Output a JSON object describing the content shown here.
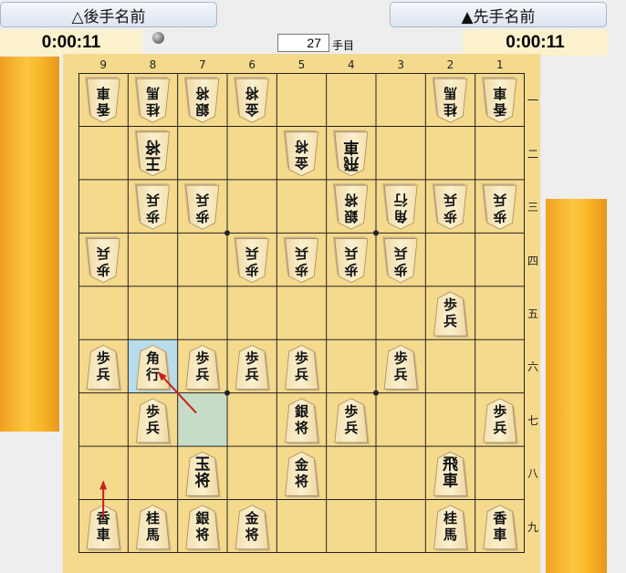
{
  "header": {
    "gote_name": "△後手名前",
    "sente_name": "▲先手名前",
    "gote_clock": "0:00:11",
    "sente_clock": "0:00:11",
    "move_number": "27",
    "move_unit": "手目"
  },
  "board": {
    "files": [
      "9",
      "8",
      "7",
      "6",
      "5",
      "4",
      "3",
      "2",
      "1"
    ],
    "ranks": [
      "一",
      "二",
      "三",
      "四",
      "五",
      "六",
      "七",
      "八",
      "九"
    ],
    "highlight_squares": [
      {
        "file": 8,
        "rank": 6
      },
      {
        "file": 7,
        "rank": 7
      }
    ],
    "last_move": {
      "from": {
        "file": 7,
        "rank": 7
      },
      "to": {
        "file": 8,
        "rank": 6
      }
    },
    "arrows": [
      {
        "from": {
          "file": 7,
          "rank": 7
        },
        "to": {
          "file": 8,
          "rank": 6
        },
        "color": "#c8201c"
      },
      {
        "from": {
          "file": 9,
          "rank": 9
        },
        "to": {
          "file": 9,
          "rank": 8
        },
        "color": "#c8201c"
      }
    ],
    "pieces": [
      {
        "file": 9,
        "rank": 1,
        "owner": "gote",
        "chars": "香車"
      },
      {
        "file": 8,
        "rank": 1,
        "owner": "gote",
        "chars": "桂馬"
      },
      {
        "file": 7,
        "rank": 1,
        "owner": "gote",
        "chars": "銀将"
      },
      {
        "file": 6,
        "rank": 1,
        "owner": "gote",
        "chars": "金将"
      },
      {
        "file": 2,
        "rank": 1,
        "owner": "gote",
        "chars": "桂馬"
      },
      {
        "file": 1,
        "rank": 1,
        "owner": "gote",
        "chars": "香車"
      },
      {
        "file": 8,
        "rank": 2,
        "owner": "gote",
        "chars": "王将",
        "king": true
      },
      {
        "file": 5,
        "rank": 2,
        "owner": "gote",
        "chars": "金将"
      },
      {
        "file": 4,
        "rank": 2,
        "owner": "gote",
        "chars": "飛車",
        "bold": true
      },
      {
        "file": 8,
        "rank": 3,
        "owner": "gote",
        "chars": "歩兵"
      },
      {
        "file": 7,
        "rank": 3,
        "owner": "gote",
        "chars": "歩兵"
      },
      {
        "file": 4,
        "rank": 3,
        "owner": "gote",
        "chars": "銀将"
      },
      {
        "file": 3,
        "rank": 3,
        "owner": "gote",
        "chars": "角行"
      },
      {
        "file": 2,
        "rank": 3,
        "owner": "gote",
        "chars": "歩兵"
      },
      {
        "file": 1,
        "rank": 3,
        "owner": "gote",
        "chars": "歩兵"
      },
      {
        "file": 9,
        "rank": 4,
        "owner": "gote",
        "chars": "歩兵"
      },
      {
        "file": 6,
        "rank": 4,
        "owner": "gote",
        "chars": "歩兵"
      },
      {
        "file": 5,
        "rank": 4,
        "owner": "gote",
        "chars": "歩兵"
      },
      {
        "file": 4,
        "rank": 4,
        "owner": "gote",
        "chars": "歩兵"
      },
      {
        "file": 3,
        "rank": 4,
        "owner": "gote",
        "chars": "歩兵"
      },
      {
        "file": 2,
        "rank": 5,
        "owner": "sente",
        "chars": "歩兵"
      },
      {
        "file": 9,
        "rank": 6,
        "owner": "sente",
        "chars": "歩兵"
      },
      {
        "file": 8,
        "rank": 6,
        "owner": "sente",
        "chars": "角行"
      },
      {
        "file": 7,
        "rank": 6,
        "owner": "sente",
        "chars": "歩兵"
      },
      {
        "file": 6,
        "rank": 6,
        "owner": "sente",
        "chars": "歩兵"
      },
      {
        "file": 5,
        "rank": 6,
        "owner": "sente",
        "chars": "歩兵"
      },
      {
        "file": 3,
        "rank": 6,
        "owner": "sente",
        "chars": "歩兵"
      },
      {
        "file": 8,
        "rank": 7,
        "owner": "sente",
        "chars": "歩兵"
      },
      {
        "file": 5,
        "rank": 7,
        "owner": "sente",
        "chars": "銀将"
      },
      {
        "file": 4,
        "rank": 7,
        "owner": "sente",
        "chars": "歩兵"
      },
      {
        "file": 1,
        "rank": 7,
        "owner": "sente",
        "chars": "歩兵"
      },
      {
        "file": 7,
        "rank": 8,
        "owner": "sente",
        "chars": "玉将",
        "bold": true
      },
      {
        "file": 5,
        "rank": 8,
        "owner": "sente",
        "chars": "金将"
      },
      {
        "file": 2,
        "rank": 8,
        "owner": "sente",
        "chars": "飛車",
        "bold": true
      },
      {
        "file": 9,
        "rank": 9,
        "owner": "sente",
        "chars": "香車"
      },
      {
        "file": 8,
        "rank": 9,
        "owner": "sente",
        "chars": "桂馬"
      },
      {
        "file": 7,
        "rank": 9,
        "owner": "sente",
        "chars": "銀将"
      },
      {
        "file": 6,
        "rank": 9,
        "owner": "sente",
        "chars": "金将"
      },
      {
        "file": 2,
        "rank": 9,
        "owner": "sente",
        "chars": "桂馬"
      },
      {
        "file": 1,
        "rank": 9,
        "owner": "sente",
        "chars": "香車"
      }
    ]
  }
}
